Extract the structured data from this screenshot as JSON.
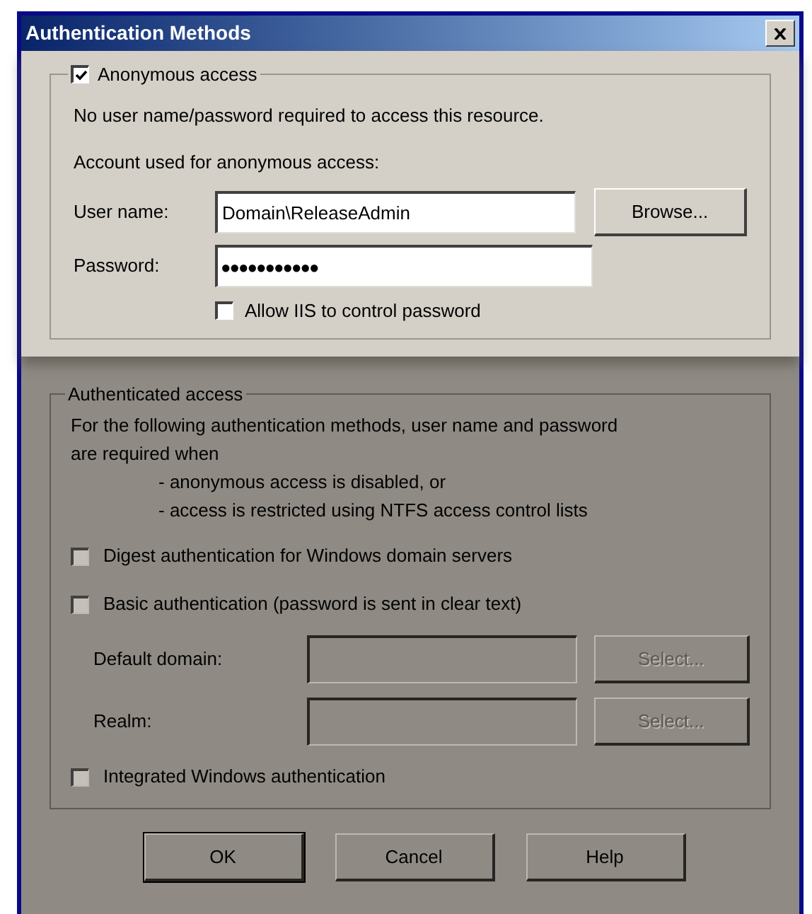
{
  "window": {
    "title": "Authentication Methods"
  },
  "anonymous_access": {
    "label": "Anonymous access",
    "checked": true,
    "description": "No user name/password required to access this resource.",
    "account_label": "Account used for anonymous access:",
    "user_name": {
      "label": "User name:",
      "value": "Domain\\ReleaseAdmin"
    },
    "browse_button": "Browse...",
    "password": {
      "label": "Password:",
      "value": "●●●●●●●●●●●"
    },
    "allow_iis": {
      "label": "Allow IIS to control password",
      "checked": false
    }
  },
  "authenticated_access": {
    "title": "Authenticated access",
    "description_lines": [
      "For the following authentication methods, user name and password",
      "are required when"
    ],
    "conditions": [
      "- anonymous access is disabled, or",
      "- access is restricted using NTFS access control lists"
    ],
    "items": [
      {
        "kind": "checkbox",
        "label": "Digest authentication for Windows domain servers",
        "checked": false
      },
      {
        "kind": "checkbox",
        "label": "Basic authentication (password is sent in clear text)",
        "checked": false
      },
      {
        "kind": "field",
        "label": "Default domain:",
        "button": "Select...",
        "disabled": true
      },
      {
        "kind": "field",
        "label": "Realm:",
        "button": "Select...",
        "disabled": true
      },
      {
        "kind": "checkbox",
        "label": "Integrated Windows authentication",
        "checked": false
      }
    ]
  },
  "buttons": [
    {
      "label": "OK",
      "default": true
    },
    {
      "label": "Cancel",
      "default": false
    },
    {
      "label": "Help",
      "default": false
    }
  ]
}
